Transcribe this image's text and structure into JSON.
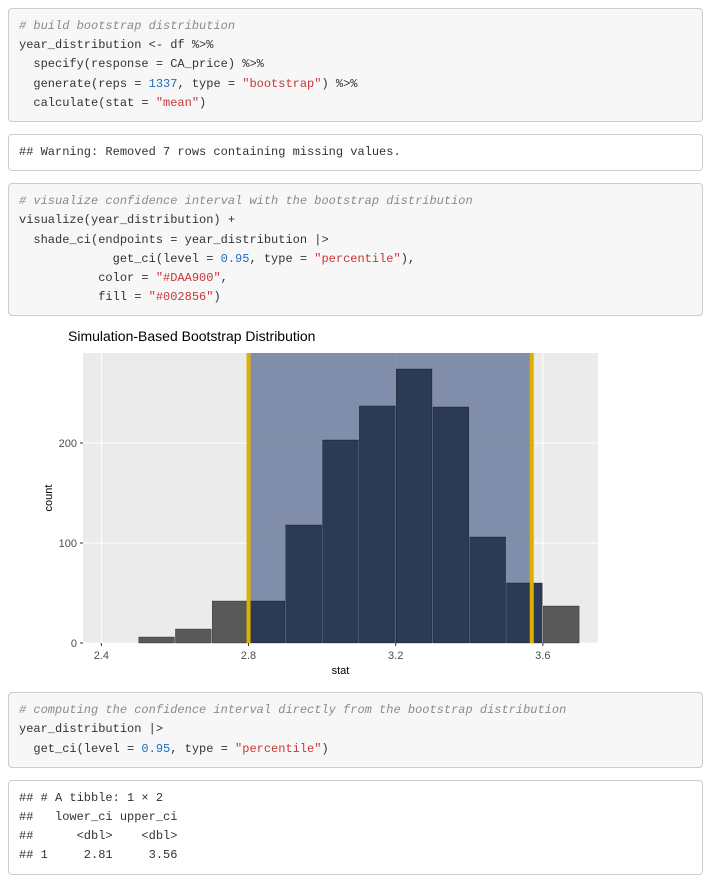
{
  "code1": {
    "comment": "# build bootstrap distribution",
    "l1a": "year_distribution <- df %>%",
    "l2a": "  specify(response = CA_price) %>%",
    "l3a": "  generate(reps = ",
    "l3n": "1337",
    "l3b": ", type = ",
    "l3s": "\"bootstrap\"",
    "l3c": ") %>%",
    "l4a": "  calculate(stat = ",
    "l4s": "\"mean\"",
    "l4b": ")"
  },
  "out1": {
    "line": "## Warning: Removed 7 rows containing missing values."
  },
  "code2": {
    "comment": "# visualize confidence interval with the bootstrap distribution",
    "l1": "visualize(year_distribution) +",
    "l2": "  shade_ci(endpoints = year_distribution |>",
    "l3a": "             get_ci(level = ",
    "l3n": "0.95",
    "l3b": ", type = ",
    "l3s": "\"percentile\"",
    "l3c": "),",
    "l4a": "           color = ",
    "l4s": "\"#DAA900\"",
    "l4b": ",",
    "l5a": "           fill = ",
    "l5s": "\"#002856\"",
    "l5b": ")"
  },
  "chart_data": {
    "type": "bar",
    "title": "Simulation-Based Bootstrap Distribution",
    "xlabel": "stat",
    "ylabel": "count",
    "x_ticks": [
      2.4,
      2.8,
      3.2,
      3.6
    ],
    "y_ticks": [
      0,
      100,
      200
    ],
    "xlim": [
      2.35,
      3.75
    ],
    "ylim": [
      0,
      290
    ],
    "bars": [
      {
        "x": 2.55,
        "count": 6
      },
      {
        "x": 2.65,
        "count": 14
      },
      {
        "x": 2.75,
        "count": 42
      },
      {
        "x": 2.85,
        "count": 42
      },
      {
        "x": 2.95,
        "count": 118
      },
      {
        "x": 3.05,
        "count": 203
      },
      {
        "x": 3.15,
        "count": 237
      },
      {
        "x": 3.25,
        "count": 274
      },
      {
        "x": 3.35,
        "count": 236
      },
      {
        "x": 3.45,
        "count": 106
      },
      {
        "x": 3.55,
        "count": 60
      },
      {
        "x": 3.65,
        "count": 37
      }
    ],
    "ci": {
      "low": 2.8,
      "high": 3.57
    },
    "bar_color": "#2b3b55",
    "bar_out_color": "#595959",
    "ci_fill": "#6e7ea0",
    "ci_line": "#e0b000",
    "panel_bg": "#ebebeb"
  },
  "code3": {
    "comment": "# computing the confidence interval directly from the bootstrap distribution",
    "l1": "year_distribution |>",
    "l2a": "  get_ci(level = ",
    "l2n": "0.95",
    "l2b": ", type = ",
    "l2s": "\"percentile\"",
    "l2c": ")"
  },
  "out2": {
    "l1": "## # A tibble: 1 × 2",
    "l2": "##   lower_ci upper_ci",
    "l3": "##      <dbl>    <dbl>",
    "l4": "## 1     2.81     3.56"
  }
}
